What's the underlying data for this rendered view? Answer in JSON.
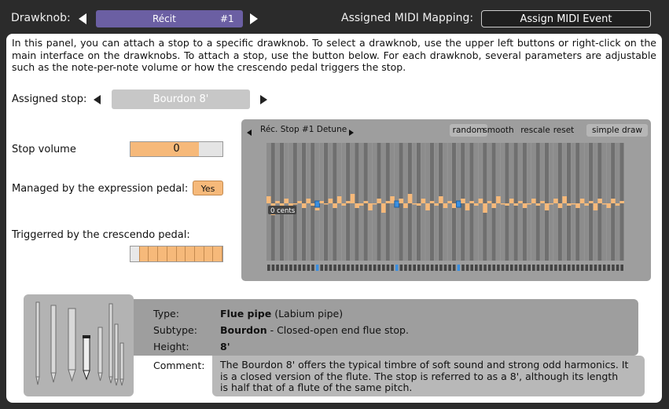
{
  "topbar": {
    "drawknob_label": "Drawknob:",
    "selector_name": "Récit",
    "selector_number": "#1",
    "mapping_label": "Assigned MIDI Mapping:",
    "assign_button": "Assign MIDI Event"
  },
  "description": "In this panel, you can attach a stop to a specific drawknob. To select a drawknob, use the upper left buttons or right-click on the main interface on the drawknobs. To attach a stop, use the button below. For each drawknob, several parameters are adjustable such as the note-per-note volume or how the crescendo pedal triggers the stop.",
  "assigned_stop": {
    "label": "Assigned stop:",
    "value": "Bourdon 8'"
  },
  "stop_volume": {
    "label": "Stop volume",
    "value": "0",
    "fraction": 0.74
  },
  "expression": {
    "label": "Managed by the expression pedal:",
    "value": "Yes"
  },
  "crescendo": {
    "label": "Triggerred by the crescendo pedal:",
    "total_cells": 10,
    "off_cells": 1
  },
  "detune": {
    "title": "Réc. Stop #1 Detune",
    "buttons": [
      "random",
      "smooth",
      "rescale",
      "reset"
    ],
    "simple_draw": "simple draw",
    "readout": "0 cents",
    "colors": {
      "bar": "#f6b97a",
      "selected": "#3b8fe0",
      "white_key": "#8c8c8c",
      "black_key": "#6f6f6f"
    },
    "values": [
      3,
      -5,
      1,
      -1,
      2,
      -2,
      0,
      1,
      -2,
      2,
      -1,
      -3,
      1,
      0,
      2,
      -2,
      3,
      -1,
      1,
      4,
      -2,
      -1,
      1,
      -3,
      0,
      2,
      -4,
      1,
      3,
      -1,
      2,
      -2,
      4,
      0,
      -1,
      2,
      -3,
      1,
      -1,
      3,
      -2,
      1,
      -2,
      0,
      2,
      -3,
      1,
      -1,
      2,
      -4,
      1,
      -2,
      3,
      0,
      -1,
      2,
      -1,
      1,
      -2,
      0,
      2,
      -1,
      1,
      -3,
      0,
      2,
      -2,
      3,
      -1,
      0,
      -2,
      2,
      -1,
      1,
      -3,
      2,
      0,
      -2,
      2,
      -1,
      1
    ],
    "selected_indices": [
      11,
      29,
      43
    ]
  },
  "info": {
    "type_label": "Type:",
    "type_bold": "Flue pipe",
    "type_rest": " (Labium pipe)",
    "subtype_label": "Subtype:",
    "subtype_bold": "Bourdon",
    "subtype_rest": " - Closed-open end flue stop.",
    "height_label": "Height:",
    "height_bold": "8'",
    "comment_label": "Comment:",
    "comment": "The Bourdon 8' offers the typical timbre of soft sound and strong odd harmonics. It is a closed version of the flute. The stop is referred to as a 8', although its length is half that of a flute of the same pitch."
  }
}
